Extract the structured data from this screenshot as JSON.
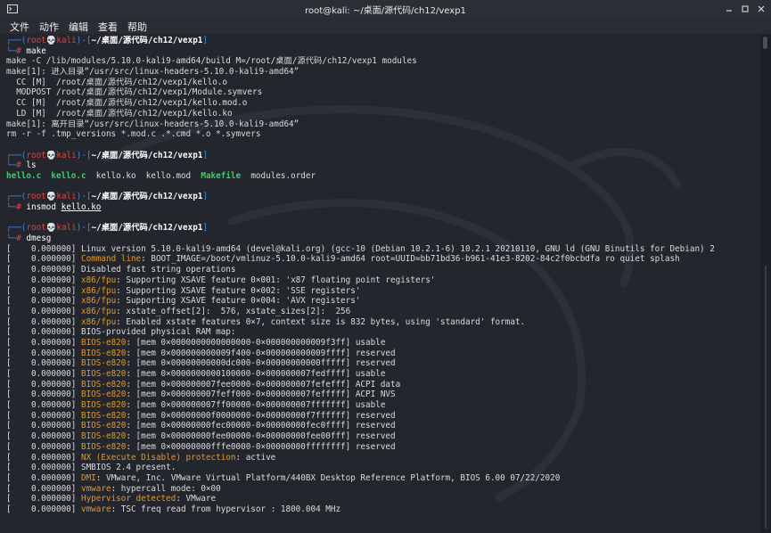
{
  "window": {
    "title": "root@kali: ~/桌面/源代码/ch12/vexp1",
    "icons": [
      "terminal-icon",
      "minimize-icon",
      "maximize-icon",
      "close-icon"
    ]
  },
  "menu": [
    "文件",
    "动作",
    "编辑",
    "查看",
    "帮助"
  ],
  "prompt": {
    "corner_top": "┌──(",
    "user": "root",
    "skull": "💀",
    "host": "kali",
    "sep": ")-[",
    "path": "~/桌面/源代码/ch12/vexp1",
    "close": "]",
    "corner_bottom": "└─",
    "hash": "#"
  },
  "commands": {
    "make": "make",
    "ls": "ls",
    "insmod": "insmod",
    "insmod_arg": "kello.ko",
    "dmesg": "dmesg"
  },
  "make_output": [
    "make -C /lib/modules/5.10.0-kali9-amd64/build M=/root/桌面/源代码/ch12/vexp1 modules",
    "make[1]: 进入目录“/usr/src/linux-headers-5.10.0-kali9-amd64”",
    "  CC [M]  /root/桌面/源代码/ch12/vexp1/kello.o",
    "  MODPOST /root/桌面/源代码/ch12/vexp1/Module.symvers",
    "  CC [M]  /root/桌面/源代码/ch12/vexp1/kello.mod.o",
    "  LD [M]  /root/桌面/源代码/ch12/vexp1/kello.ko",
    "make[1]: 离开目录“/usr/src/linux-headers-5.10.0-kali9-amd64”",
    "rm -r -f .tmp_versions *.mod.c .*.cmd *.o *.symvers"
  ],
  "ls_output": [
    {
      "name": "hello.c",
      "style": "green"
    },
    {
      "name": "kello.c",
      "style": "green"
    },
    {
      "name": "kello.ko",
      "style": "plain"
    },
    {
      "name": "kello.mod",
      "style": "plain"
    },
    {
      "name": "Makefile",
      "style": "green"
    },
    {
      "name": "modules.order",
      "style": "plain"
    }
  ],
  "dmesg": [
    {
      "ts": "[    0.000000]",
      "tag": "",
      "msg": "Linux version 5.10.0-kali9-amd64 (devel@kali.org) (gcc-10 (Debian 10.2.1-6) 10.2.1 20210110, GNU ld (GNU Binutils for Debian) 2"
    },
    {
      "ts": "[    0.000000]",
      "tag": "Command line",
      "msg": ": BOOT_IMAGE=/boot/vmlinuz-5.10.0-kali9-amd64 root=UUID=bb71bd36-b961-41e3-8202-84c2f0bcbdfa ro quiet splash"
    },
    {
      "ts": "[    0.000000]",
      "tag": "",
      "msg": "Disabled fast string operations"
    },
    {
      "ts": "[    0.000000]",
      "tag": "x86/fpu",
      "msg": ": Supporting XSAVE feature 0×001: 'x87 floating point registers'"
    },
    {
      "ts": "[    0.000000]",
      "tag": "x86/fpu",
      "msg": ": Supporting XSAVE feature 0×002: 'SSE registers'"
    },
    {
      "ts": "[    0.000000]",
      "tag": "x86/fpu",
      "msg": ": Supporting XSAVE feature 0×004: 'AVX registers'"
    },
    {
      "ts": "[    0.000000]",
      "tag": "x86/fpu",
      "msg": ": xstate_offset[2]:  576, xstate_sizes[2]:  256"
    },
    {
      "ts": "[    0.000000]",
      "tag": "x86/fpu",
      "msg": ": Enabled xstate features 0×7, context size is 832 bytes, using 'standard' format."
    },
    {
      "ts": "[    0.000000]",
      "tag": "",
      "msg": "BIOS-provided physical RAM map:"
    },
    {
      "ts": "[    0.000000]",
      "tag": "BIOS-e820",
      "msg": ": [mem 0×0000000000000000-0×000000000009f3ff] usable"
    },
    {
      "ts": "[    0.000000]",
      "tag": "BIOS-e820",
      "msg": ": [mem 0×000000000009f400-0×000000000009ffff] reserved"
    },
    {
      "ts": "[    0.000000]",
      "tag": "BIOS-e820",
      "msg": ": [mem 0×00000000000dc000-0×00000000000fffff] reserved"
    },
    {
      "ts": "[    0.000000]",
      "tag": "BIOS-e820",
      "msg": ": [mem 0×0000000000100000-0×000000007fedffff] usable"
    },
    {
      "ts": "[    0.000000]",
      "tag": "BIOS-e820",
      "msg": ": [mem 0×000000007fee0000-0×000000007fefefff] ACPI data"
    },
    {
      "ts": "[    0.000000]",
      "tag": "BIOS-e820",
      "msg": ": [mem 0×000000007feff000-0×000000007fefffff] ACPI NVS"
    },
    {
      "ts": "[    0.000000]",
      "tag": "BIOS-e820",
      "msg": ": [mem 0×000000007ff00000-0×000000007fffffff] usable"
    },
    {
      "ts": "[    0.000000]",
      "tag": "BIOS-e820",
      "msg": ": [mem 0×00000000f0000000-0×00000000f7ffffff] reserved"
    },
    {
      "ts": "[    0.000000]",
      "tag": "BIOS-e820",
      "msg": ": [mem 0×00000000fec00000-0×00000000fec0ffff] reserved"
    },
    {
      "ts": "[    0.000000]",
      "tag": "BIOS-e820",
      "msg": ": [mem 0×00000000fee00000-0×00000000fee00fff] reserved"
    },
    {
      "ts": "[    0.000000]",
      "tag": "BIOS-e820",
      "msg": ": [mem 0×00000000fffe0000-0×00000000ffffffff] reserved"
    },
    {
      "ts": "[    0.000000]",
      "tag": "NX (Execute Disable) protection",
      "msg": ": active"
    },
    {
      "ts": "[    0.000000]",
      "tag": "",
      "msg": "SMBIOS 2.4 present."
    },
    {
      "ts": "[    0.000000]",
      "tag": "DMI",
      "msg": ": VMware, Inc. VMware Virtual Platform/440BX Desktop Reference Platform, BIOS 6.00 07/22/2020"
    },
    {
      "ts": "[    0.000000]",
      "tag": "vmware",
      "msg": ": hypercall mode: 0×00"
    },
    {
      "ts": "[    0.000000]",
      "tag": "Hypervisor detected",
      "msg": ": VMware"
    },
    {
      "ts": "[    0.000000]",
      "tag": "vmware",
      "msg": ": TSC freq read from hypervisor : 1800.004 MHz"
    }
  ],
  "colors": {
    "prompt_frame": "#3b8eea",
    "prompt_user": "#e0443e",
    "dmesg_tag": "#e09a2a",
    "ls_highlight": "#3cd06a",
    "background": "#23262d"
  }
}
